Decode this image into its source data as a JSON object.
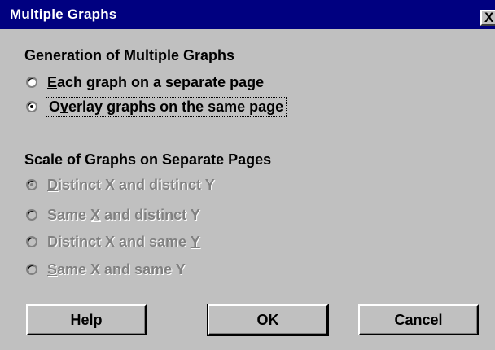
{
  "window": {
    "title": "Multiple Graphs",
    "close_glyph": "X"
  },
  "generation": {
    "label": "Generation of Multiple Graphs",
    "options": [
      {
        "hotkey": "E",
        "rest": "ach graph on a separate page",
        "selected": false,
        "enabled": true
      },
      {
        "pre": "O",
        "hotkey": "v",
        "rest": "erlay graphs on the same page",
        "selected": true,
        "enabled": true
      }
    ]
  },
  "scale": {
    "label": "Scale of Graphs on Separate Pages",
    "options": [
      {
        "hotkey": "D",
        "rest": "istinct X and distinct Y",
        "selected": true,
        "enabled": false
      },
      {
        "pre": "Same ",
        "hotkey": "X",
        "rest": " and distinct Y",
        "selected": false,
        "enabled": false
      },
      {
        "pre": "Distinct X and same ",
        "hotkey": "Y",
        "rest": "",
        "selected": false,
        "enabled": false
      },
      {
        "hotkey": "S",
        "rest": "ame X and same Y",
        "selected": false,
        "enabled": false
      }
    ]
  },
  "buttons": {
    "help": "Help",
    "ok_hotkey": "O",
    "ok_rest": "K",
    "cancel": "Cancel"
  }
}
